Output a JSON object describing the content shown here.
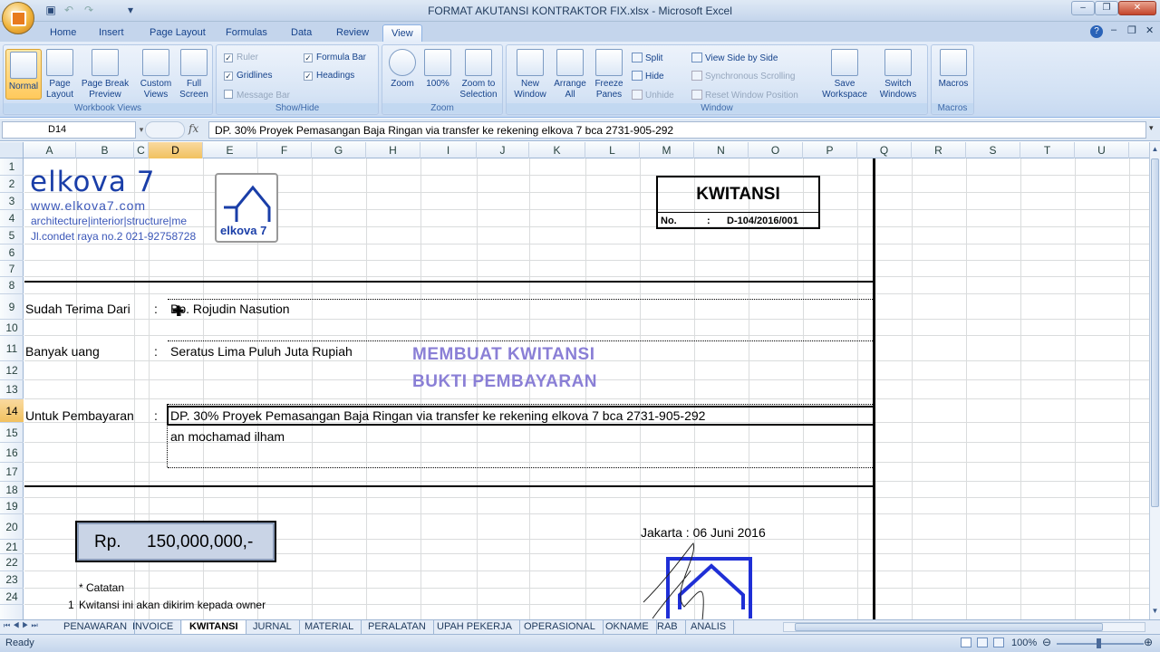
{
  "window": {
    "title": "FORMAT AKUTANSI KONTRAKTOR FIX.xlsx - Microsoft Excel"
  },
  "ribbon": {
    "tabs": [
      "Home",
      "Insert",
      "Page Layout",
      "Formulas",
      "Data",
      "Review",
      "View"
    ],
    "active_tab": "View",
    "groups": {
      "workbook_views": {
        "label": "Workbook Views",
        "normal": "Normal",
        "page_layout": "Page Layout",
        "page_break": "Page Break Preview",
        "custom_views": "Custom Views",
        "full_screen": "Full Screen"
      },
      "show_hide": {
        "label": "Show/Hide",
        "ruler": "Ruler",
        "gridlines": "Gridlines",
        "message_bar": "Message Bar",
        "formula_bar": "Formula Bar",
        "headings": "Headings"
      },
      "zoom": {
        "label": "Zoom",
        "zoom": "Zoom",
        "hundred": "100%",
        "zoom_selection": "Zoom to Selection"
      },
      "window": {
        "label": "Window",
        "new_window": "New Window",
        "arrange_all": "Arrange All",
        "freeze_panes": "Freeze Panes",
        "split": "Split",
        "hide": "Hide",
        "unhide": "Unhide",
        "view_side": "View Side by Side",
        "sync_scroll": "Synchronous Scrolling",
        "reset_pos": "Reset Window Position",
        "save_ws": "Save Workspace",
        "switch_windows": "Switch Windows"
      },
      "macros": {
        "label": "Macros",
        "macros": "Macros"
      }
    }
  },
  "formula_bar": {
    "name_box": "D14",
    "fx": "fx",
    "value": "DP. 30% Proyek Pemasangan Baja Ringan via transfer ke rekening elkova 7 bca 2731-905-292"
  },
  "columns": [
    "A",
    "B",
    "C",
    "D",
    "E",
    "F",
    "G",
    "H",
    "I",
    "J",
    "K",
    "L",
    "M",
    "N",
    "O",
    "P",
    "Q",
    "R",
    "S",
    "T",
    "U"
  ],
  "selected_column": "D",
  "rows": [
    "1",
    "2",
    "3",
    "4",
    "5",
    "6",
    "7",
    "8",
    "9",
    "10",
    "11",
    "12",
    "13",
    "14",
    "15",
    "16",
    "17",
    "18",
    "19",
    "20",
    "21",
    "22",
    "23",
    "24"
  ],
  "selected_row": "14",
  "sheet": {
    "logo": {
      "brand": "elkova 7",
      "url": "www.elkova7.com",
      "tagline": "architecture|interior|structure|me",
      "address": "Jl.condet raya no.2   021-92758728",
      "badge": "elkova 7"
    },
    "kwitansi": {
      "title": "KWITANSI",
      "no_label": "No.",
      "colon": ":",
      "number": "D-104/2016/001"
    },
    "received_from": {
      "label": "Sudah Terima Dari",
      "colon": ":",
      "value": "Bp. Rojudin Nasution"
    },
    "amount_words": {
      "label": "Banyak uang",
      "colon": ":",
      "value": "Seratus Lima Puluh Juta Rupiah"
    },
    "overlay": {
      "line1": "MEMBUAT KWITANSI",
      "line2": "BUKTI PEMBAYARAN"
    },
    "payment_for": {
      "label": "Untuk Pembayaran",
      "colon": ":",
      "line1": "DP. 30% Proyek Pemasangan Baja Ringan via transfer ke rekening elkova 7 bca 2731-905-292",
      "line2": "an mochamad ilham"
    },
    "amount_box": {
      "currency": "Rp.",
      "value": "150,000,000,-"
    },
    "place_date": "Jakarta : 06 Juni 2016",
    "notes": {
      "title": "* Catatan",
      "num": "1",
      "item1": "Kwitansi ini akan dikirim kepada owner"
    }
  },
  "sheet_tabs": [
    "PENAWARAN",
    "INVOICE",
    "KWITANSI",
    "JURNAL",
    "MATERIAL",
    "PERALATAN",
    "UPAH PEKERJA",
    "OPERASIONAL",
    "OKNAME",
    "RAB",
    "ANALIS"
  ],
  "active_sheet": "KWITANSI",
  "status": {
    "ready": "Ready",
    "zoom": "100%"
  }
}
